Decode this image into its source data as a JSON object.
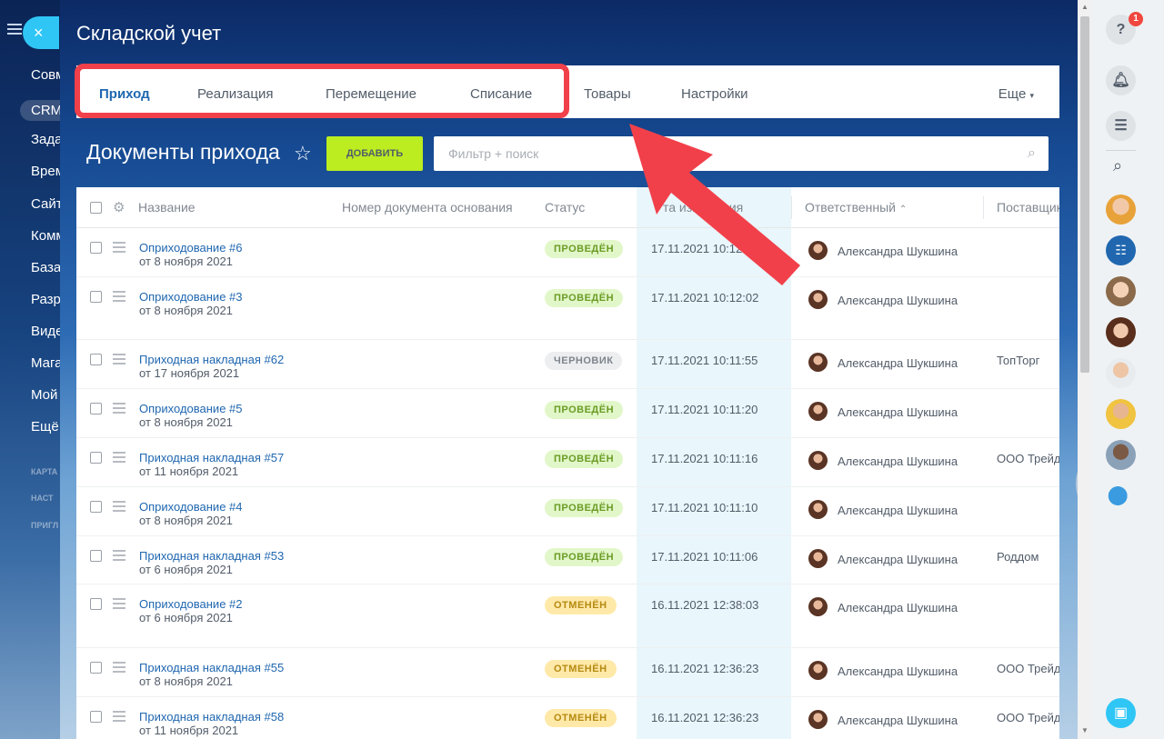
{
  "sidebar": {
    "close_label": "×",
    "items": [
      "Совм",
      "CRM",
      "Зада",
      "Врем",
      "Сайт",
      "Комм",
      "База",
      "Разр",
      "Виде",
      "Мага",
      "Мой",
      "Ещё"
    ],
    "small_items": [
      "КАРТА",
      "НАСТ",
      "ПРИГЛ"
    ]
  },
  "panel": {
    "title": "Складской учет",
    "tabs": [
      "Приход",
      "Реализация",
      "Перемещение",
      "Списание",
      "Товары",
      "Настройки"
    ],
    "more_label": "Еще",
    "doc_title": "Документы прихода",
    "add_button": "ДОБАВИТЬ",
    "filter_placeholder": "Фильтр + поиск"
  },
  "grid": {
    "columns": {
      "name": "Название",
      "base_doc": "Номер документа основания",
      "status": "Статус",
      "changed": "та изменения",
      "responsible": "Ответственный",
      "supplier": "Поставщик"
    },
    "rows": [
      {
        "name": "Оприходование #6",
        "date_sub": "от 8 ноября 2021",
        "status": "ПРОВЕДЁН",
        "status_type": "green",
        "changed": "17.11.2021 10:12:07",
        "responsible": "Александра Шукшина",
        "supplier": ""
      },
      {
        "name": "Оприходование #3",
        "date_sub": "от 8 ноября 2021",
        "status": "ПРОВЕДЁН",
        "status_type": "green",
        "changed": "17.11.2021 10:12:02",
        "responsible": "Александра Шукшина",
        "supplier": ""
      },
      {
        "name": "Приходная накладная #62",
        "date_sub": "от 17 ноября 2021",
        "status": "ЧЕРНОВИК",
        "status_type": "gray",
        "changed": "17.11.2021 10:11:55",
        "responsible": "Александра Шукшина",
        "supplier": "ТопТорг"
      },
      {
        "name": "Оприходование #5",
        "date_sub": "от 8 ноября 2021",
        "status": "ПРОВЕДЁН",
        "status_type": "green",
        "changed": "17.11.2021 10:11:20",
        "responsible": "Александра Шукшина",
        "supplier": ""
      },
      {
        "name": "Приходная накладная #57",
        "date_sub": "от 11 ноября 2021",
        "status": "ПРОВЕДЁН",
        "status_type": "green",
        "changed": "17.11.2021 10:11:16",
        "responsible": "Александра Шукшина",
        "supplier": "ООО Трейд"
      },
      {
        "name": "Оприходование #4",
        "date_sub": "от 8 ноября 2021",
        "status": "ПРОВЕДЁН",
        "status_type": "green",
        "changed": "17.11.2021 10:11:10",
        "responsible": "Александра Шукшина",
        "supplier": ""
      },
      {
        "name": "Приходная накладная #53",
        "date_sub": "от 6 ноября 2021",
        "status": "ПРОВЕДЁН",
        "status_type": "green",
        "changed": "17.11.2021 10:11:06",
        "responsible": "Александра Шукшина",
        "supplier": "Роддом"
      },
      {
        "name": "Оприходование #2",
        "date_sub": "от 6 ноября 2021",
        "status": "ОТМЕНЁН",
        "status_type": "orange",
        "changed": "16.11.2021 12:38:03",
        "responsible": "Александра Шукшина",
        "supplier": ""
      },
      {
        "name": "Приходная накладная #55",
        "date_sub": "от 8 ноября 2021",
        "status": "ОТМЕНЁН",
        "status_type": "orange",
        "changed": "16.11.2021 12:36:23",
        "responsible": "Александра Шукшина",
        "supplier": "ООО Трейд"
      },
      {
        "name": "Приходная накладная #58",
        "date_sub": "от 11 ноября 2021",
        "status": "ОТМЕНЁН",
        "status_type": "orange",
        "changed": "16.11.2021 12:36:23",
        "responsible": "Александра Шукшина",
        "supplier": "ООО Трейд"
      }
    ]
  },
  "rightbar": {
    "help_icon": "?",
    "notification_count": "1"
  },
  "colors": {
    "accent_link": "#2067b0",
    "add_button": "#bbed21",
    "highlight": "#f1404a",
    "status_green": "#6b9c26",
    "status_orange": "#b58a10"
  }
}
